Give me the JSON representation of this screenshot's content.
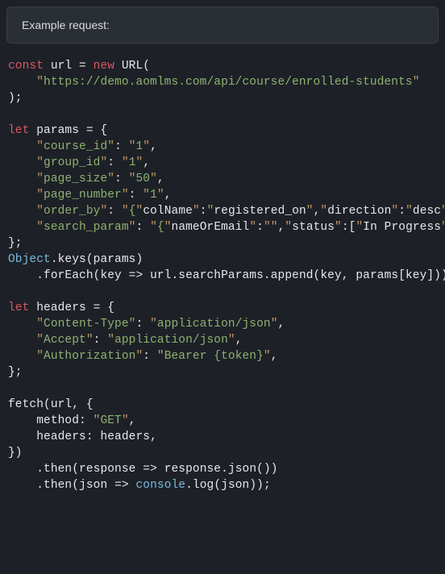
{
  "header": {
    "label": "Example request:"
  },
  "code": {
    "kw_const": "const",
    "kw_let": "let",
    "kw_new": "new",
    "url_var": "url",
    "URL_cls": "URL",
    "url_str": "https://demo.aomlms.com/api/course/enrolled-students",
    "params_var": "params",
    "params": {
      "course_id_key": "course_id",
      "course_id_val": "1",
      "group_id_key": "group_id",
      "group_id_val": "1",
      "page_size_key": "page_size",
      "page_size_val": "50",
      "page_number_key": "page_number",
      "page_number_val": "1",
      "order_by_key": "order_by",
      "order_by_open": "{",
      "order_by_colname_k": "colName",
      "order_by_colname_v": "registered_on",
      "order_by_dir_k": "direction",
      "order_by_dir_v": "desc",
      "order_by_close": "}",
      "search_param_key": "search_param",
      "search_open": "{",
      "search_name_k": "nameOrEmail",
      "search_name_v": "",
      "search_status_k": "status",
      "search_status_v": "In Progress",
      "search_close": "]}"
    },
    "Object_cls": "Object",
    "keys": "keys",
    "forEach": "forEach",
    "arrow_key": "key",
    "searchParams": "searchParams",
    "append": "append",
    "headers_var": "headers",
    "headers": {
      "ct_key": "Content-Type",
      "ct_val": "application/json",
      "accept_key": "Accept",
      "accept_val": "application/json",
      "auth_key": "Authorization",
      "auth_val": "Bearer {token}"
    },
    "fetch": "fetch",
    "method_key": "method",
    "method_val": "GET",
    "headers_key": "headers",
    "then": "then",
    "response": "response",
    "json": "json",
    "console_cls": "console",
    "log": "log"
  }
}
